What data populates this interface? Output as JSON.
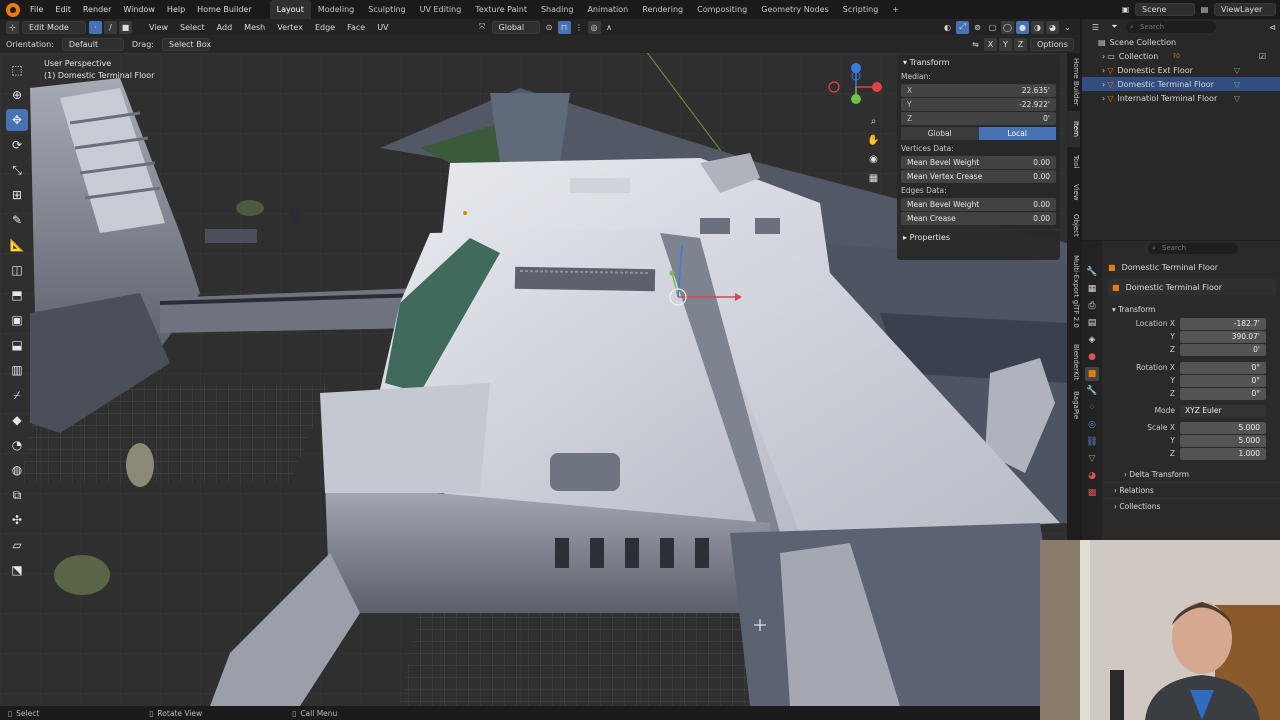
{
  "menu": {
    "items": [
      "File",
      "Edit",
      "Render",
      "Window",
      "Help",
      "Home Builder"
    ],
    "workspaces": [
      "Layout",
      "Modeling",
      "Sculpting",
      "UV Editing",
      "Texture Paint",
      "Shading",
      "Animation",
      "Rendering",
      "Compositing",
      "Geometry Nodes",
      "Scripting"
    ],
    "active_workspace": "Layout",
    "add_tab": "+",
    "scene": "Scene",
    "view_layer": "ViewLayer"
  },
  "viewport_header": {
    "mode": "Edit Mode",
    "menus": [
      "View",
      "Select",
      "Add",
      "Mesh",
      "Vertex",
      "Edge",
      "Face",
      "UV"
    ],
    "transform_orientation": "Global",
    "axes": [
      "X",
      "Y",
      "Z"
    ],
    "options": "Options"
  },
  "tool_header": {
    "orientation_label": "Orientation:",
    "orientation_value": "Default",
    "drag_label": "Drag:",
    "drag_value": "Select Box"
  },
  "viewport": {
    "perspective": "User Perspective",
    "object_label": "(1) Domestic Terminal Floor"
  },
  "npanel": {
    "title": "Transform",
    "median_label": "Median:",
    "median": [
      {
        "axis": "X",
        "value": "22.635'"
      },
      {
        "axis": "Y",
        "value": "-22.922'"
      },
      {
        "axis": "Z",
        "value": "0'"
      }
    ],
    "space_options": [
      "Global",
      "Local"
    ],
    "space_active": "Local",
    "vertices_label": "Vertices Data:",
    "vertices": [
      {
        "label": "Mean Bevel Weight",
        "value": "0.00"
      },
      {
        "label": "Mean Vertex Crease",
        "value": "0.00"
      }
    ],
    "edges_label": "Edges Data:",
    "edges": [
      {
        "label": "Mean Bevel Weight",
        "value": "0.00"
      },
      {
        "label": "Mean Crease",
        "value": "0.00"
      }
    ],
    "properties": "Properties"
  },
  "side_tabs": [
    "Home Builder",
    "Item",
    "Tool",
    "View",
    "Object",
    "Multi-Export glTF 2.0",
    "BlenderKit",
    "BagaPie"
  ],
  "outliner": {
    "search_placeholder": "Search",
    "collection_root": "Scene Collection",
    "collection": "Collection",
    "collection_badge": "70",
    "objects": [
      "Domestic Ext Floor",
      "Domestic Terminal Floor",
      "Internatiol Terminal Floor"
    ],
    "selected": "Domestic Terminal Floor"
  },
  "properties": {
    "search_placeholder": "Search",
    "object_name": "Domestic Terminal Floor",
    "object_field": "Domestic Terminal Floor",
    "transform": "Transform",
    "location": [
      {
        "label": "Location X",
        "value": "-182.7'"
      },
      {
        "label": "Y",
        "value": "390.07'"
      },
      {
        "label": "Z",
        "value": "0'"
      }
    ],
    "rotation": [
      {
        "label": "Rotation X",
        "value": "0°"
      },
      {
        "label": "Y",
        "value": "0°"
      },
      {
        "label": "Z",
        "value": "0°"
      }
    ],
    "mode_label": "Mode",
    "mode_value": "XYZ Euler",
    "scale": [
      {
        "label": "Scale X",
        "value": "5.000"
      },
      {
        "label": "Y",
        "value": "5.000"
      },
      {
        "label": "Z",
        "value": "1.000"
      }
    ],
    "delta_transform": "Delta Transform",
    "relations": "Relations",
    "collections": "Collections"
  },
  "statusbar": {
    "select": "Select",
    "rotate": "Rotate View",
    "call_menu": "Call Menu"
  },
  "colors": {
    "accent": "#4772b3",
    "selected_row": "#334d80",
    "object_orange": "#e87d0d",
    "mesh_green": "#6fbf4a"
  }
}
